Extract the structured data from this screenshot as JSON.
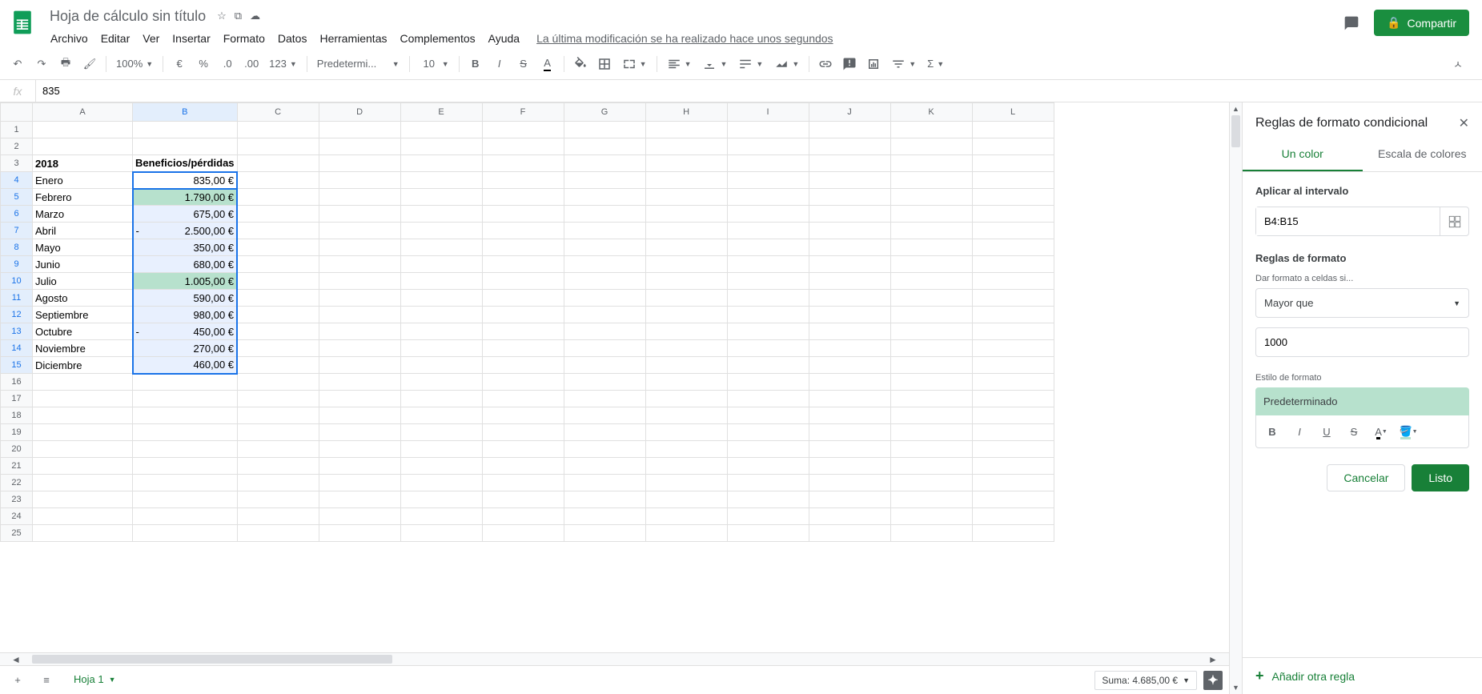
{
  "doc_title": "Hoja de cálculo sin título",
  "menus": [
    "Archivo",
    "Editar",
    "Ver",
    "Insertar",
    "Formato",
    "Datos",
    "Herramientas",
    "Complementos",
    "Ayuda"
  ],
  "last_modified": "La última modificación se ha realizado hace unos segundos",
  "share": "Compartir",
  "zoom": "100%",
  "font": "Predetermi...",
  "font_size": "10",
  "number_format": "123",
  "formula_value": "835",
  "columns": [
    "A",
    "B",
    "C",
    "D",
    "E",
    "F",
    "G",
    "H",
    "I",
    "J",
    "K",
    "L"
  ],
  "data": {
    "a3": "2018",
    "b3": "Beneficios/pérdidas",
    "rows": [
      {
        "r": 4,
        "a": "Enero",
        "b": "835,00 €",
        "neg": false,
        "hl": false,
        "active": true
      },
      {
        "r": 5,
        "a": "Febrero",
        "b": "1.790,00 €",
        "neg": false,
        "hl": true
      },
      {
        "r": 6,
        "a": "Marzo",
        "b": "675,00 €",
        "neg": false,
        "hl": false
      },
      {
        "r": 7,
        "a": "Abril",
        "b": "2.500,00 €",
        "neg": true,
        "hl": false
      },
      {
        "r": 8,
        "a": "Mayo",
        "b": "350,00 €",
        "neg": false,
        "hl": false
      },
      {
        "r": 9,
        "a": "Junio",
        "b": "680,00 €",
        "neg": false,
        "hl": false
      },
      {
        "r": 10,
        "a": "Julio",
        "b": "1.005,00 €",
        "neg": false,
        "hl": true
      },
      {
        "r": 11,
        "a": "Agosto",
        "b": "590,00 €",
        "neg": false,
        "hl": false
      },
      {
        "r": 12,
        "a": "Septiembre",
        "b": "980,00 €",
        "neg": false,
        "hl": false
      },
      {
        "r": 13,
        "a": "Octubre",
        "b": "450,00 €",
        "neg": true,
        "hl": false
      },
      {
        "r": 14,
        "a": "Noviembre",
        "b": "270,00 €",
        "neg": false,
        "hl": false
      },
      {
        "r": 15,
        "a": "Diciembre",
        "b": "460,00 €",
        "neg": false,
        "hl": false
      }
    ]
  },
  "sheet_tab": "Hoja 1",
  "summary": "Suma: 4.685,00 €",
  "sidepanel": {
    "title": "Reglas de formato condicional",
    "tab1": "Un color",
    "tab2": "Escala de colores",
    "apply_label": "Aplicar al intervalo",
    "range": "B4:B15",
    "rules_label": "Reglas de formato",
    "condition_label": "Dar formato a celdas si...",
    "condition": "Mayor que",
    "value": "1000",
    "style_label": "Estilo de formato",
    "style_preview": "Predeterminado",
    "cancel": "Cancelar",
    "done": "Listo",
    "add_rule": "Añadir otra regla"
  }
}
